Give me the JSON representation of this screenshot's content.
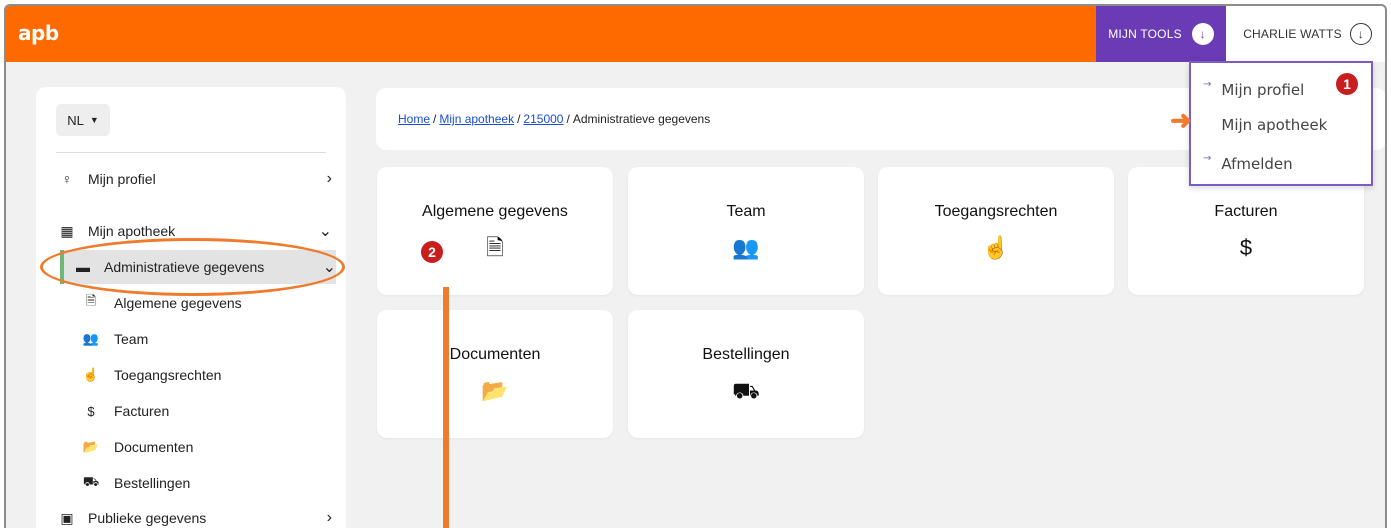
{
  "app": {
    "logo": "apb"
  },
  "topbar": {
    "tools_label": "MIJN TOOLS",
    "user_label": "CHARLIE WATTS",
    "arrow_glyph": "↓"
  },
  "dropdown": {
    "items": [
      {
        "label": "Mijn profiel"
      },
      {
        "label": "Mijn apotheek"
      },
      {
        "label": "Afmelden"
      }
    ],
    "item_arrow": "→"
  },
  "sidebar": {
    "language": "NL",
    "items": [
      {
        "label": "Mijn profiel",
        "icon": "user-icon",
        "glyph": "♀",
        "chevron": "›"
      },
      {
        "label": "Mijn apotheek",
        "icon": "pharmacy-icon",
        "glyph": "▦",
        "chevron": "⌄"
      },
      {
        "label": "Administratieve gegevens",
        "icon": "archive-icon",
        "glyph": "▬",
        "chevron": "⌄"
      },
      {
        "label": "Publieke gegevens",
        "icon": "id-card-icon",
        "glyph": "▣",
        "chevron": "›"
      }
    ],
    "subitems": [
      {
        "label": "Algemene gegevens",
        "icon": "file-icon",
        "glyph": "🗎"
      },
      {
        "label": "Team",
        "icon": "team-icon",
        "glyph": "👥"
      },
      {
        "label": "Toegangsrechten",
        "icon": "fingerprint-icon",
        "glyph": "☝"
      },
      {
        "label": "Facturen",
        "icon": "invoice-icon",
        "glyph": "$"
      },
      {
        "label": "Documenten",
        "icon": "folder-icon",
        "glyph": "📂"
      },
      {
        "label": "Bestellingen",
        "icon": "cart-icon",
        "glyph": "⛟"
      }
    ]
  },
  "breadcrumb": {
    "links": [
      "Home",
      "Mijn apotheek",
      "215000"
    ],
    "current": "Administratieve gegevens",
    "separator": "/"
  },
  "cards": [
    {
      "label": "Algemene gegevens",
      "icon": "file-icon",
      "glyph": "🗎"
    },
    {
      "label": "Team",
      "icon": "team-icon",
      "glyph": "👥"
    },
    {
      "label": "Toegangsrechten",
      "icon": "fingerprint-icon",
      "glyph": "☝"
    },
    {
      "label": "Facturen",
      "icon": "invoice-icon",
      "glyph": "$"
    },
    {
      "label": "Documenten",
      "icon": "folder-icon",
      "glyph": "📂"
    },
    {
      "label": "Bestellingen",
      "icon": "cart-icon",
      "glyph": "⛟"
    }
  ],
  "annotations": {
    "badge_1": "1",
    "badge_2": "2",
    "arrow": "➜"
  },
  "colors": {
    "brand_orange": "#fe6a00",
    "tools_purple": "#6a3bb5",
    "active_green": "#6db875",
    "annotation_orange": "#f07b2c",
    "badge_red": "#c81e1e",
    "link_blue": "#1a4fd1"
  }
}
